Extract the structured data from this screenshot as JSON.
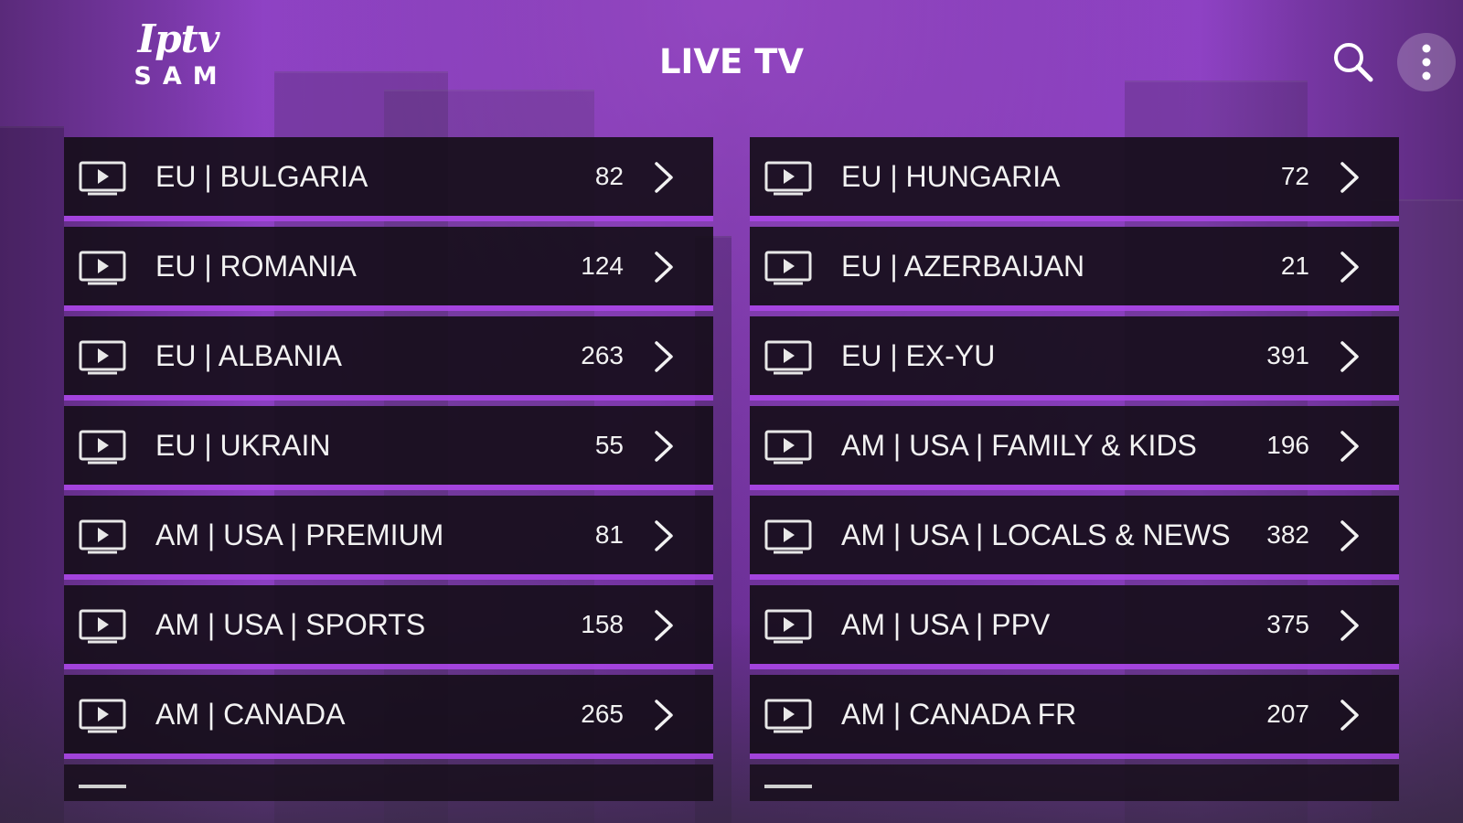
{
  "header": {
    "logo_script": "Iptv",
    "logo_word": "SAM",
    "title": "LIVE TV"
  },
  "icons": {
    "search": "search-icon",
    "more": "more-vertical-icon",
    "play": "tv-play-icon",
    "chevron": "chevron-right-icon"
  },
  "colors": {
    "accent": "#a855e0",
    "row_bg": "#160e1a",
    "text": "#f2f2f2"
  },
  "left": [
    {
      "label": "EU | BULGARIA",
      "count": "82"
    },
    {
      "label": "EU | ROMANIA",
      "count": "124"
    },
    {
      "label": "EU | ALBANIA",
      "count": "263"
    },
    {
      "label": "EU | UKRAIN",
      "count": "55"
    },
    {
      "label": "AM | USA | PREMIUM",
      "count": "81"
    },
    {
      "label": "AM | USA | SPORTS",
      "count": "158"
    },
    {
      "label": "AM | CANADA",
      "count": "265"
    }
  ],
  "right": [
    {
      "label": "EU | HUNGARIA",
      "count": "72"
    },
    {
      "label": "EU | AZERBAIJAN",
      "count": "21"
    },
    {
      "label": "EU | EX-YU",
      "count": "391"
    },
    {
      "label": "AM | USA | FAMILY & KIDS",
      "count": "196"
    },
    {
      "label": "AM | USA | LOCALS & NEWS",
      "count": "382"
    },
    {
      "label": "AM | USA | PPV",
      "count": "375"
    },
    {
      "label": "AM | CANADA FR",
      "count": "207"
    }
  ]
}
